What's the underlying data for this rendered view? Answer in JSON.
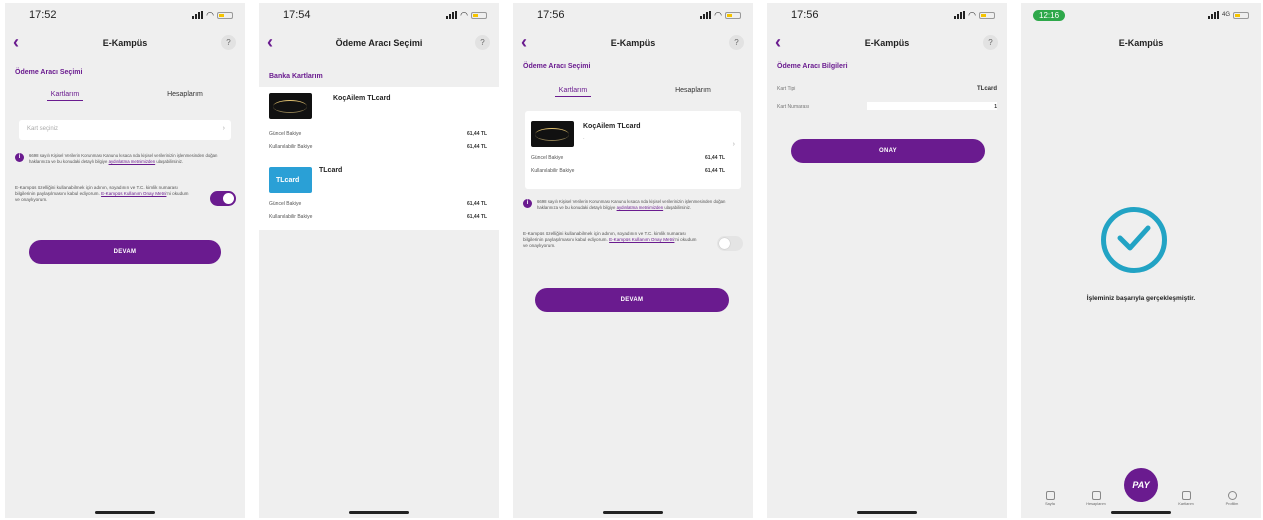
{
  "common": {
    "title_kampus": "E-Kampüs",
    "help": "?",
    "back": "‹",
    "devam": "DEVAM"
  },
  "s1": {
    "time": "17:52",
    "section": "Ödeme Aracı Seçimi",
    "tab_cards": "Kartlarım",
    "tab_accounts": "Hesaplarım",
    "input_placeholder": "Kart seçiniz",
    "info_text": "6698 sayılı Kişisel Verilerin Korunması Kanunu kısaca nda kişisel verilerinizin işlenmesinden doğan haklarınıza ve bu konudaki detaylı bilgiye",
    "info_link": "aydınlatma metnimizden",
    "info_tail": " ulaşabilirsiniz.",
    "consent_text": "E-Kampüs özelliğini kullanabilmek için adının, soyadının ve T.C. kimlik numarası bilgilerinin paylaşılmasını kabul ediyorum.",
    "consent_link": "E-Kampüs Kullanım Onay Metni",
    "consent_tail": "'ni okudum ve onaylıyorum."
  },
  "s2": {
    "time": "17:54",
    "title": "Ödeme Aracı Seçimi",
    "section": "Banka Kartlarım",
    "cards": [
      {
        "name": "KoçAilem TLcard",
        "thumb_label": "",
        "balance_label": "Güncel Bakiye",
        "balance": "61,44 TL",
        "usable_label": "Kullanılabilir Bakiye",
        "usable": "61,44 TL"
      },
      {
        "name": "TLcard",
        "thumb_label": "TLcard",
        "balance_label": "Güncel Bakiye",
        "balance": "61,44 TL",
        "usable_label": "Kullanılabilir Bakiye",
        "usable": "61,44 TL"
      }
    ]
  },
  "s3": {
    "time": "17:56",
    "section": "Ödeme Aracı Seçimi",
    "tab_cards": "Kartlarım",
    "tab_accounts": "Hesaplarım",
    "card": {
      "name": "KoçAilem TLcard",
      "sub": "-",
      "balance_label": "Güncel Bakiye",
      "balance": "61,44 TL",
      "usable_label": "Kullanılabilir Bakiye",
      "usable": "61,44 TL"
    },
    "info_text": "6698 sayılı Kişisel Verilerin Korunması Kanunu kısaca nda kişisel verilerinizin işlenmesinden doğan haklarınıza ve bu konudaki detaylı bilgiye",
    "info_link": "aydınlatma metnimizden",
    "info_tail": " ulaşabilirsiniz.",
    "consent_text": "E-Kampüs özelliğini kullanabilmek için adının, soyadının ve T.C. kimlik numarası bilgilerinin paylaşılmasını kabul ediyorum.",
    "consent_link": "E-Kampüs Kullanım Onay Metni",
    "consent_tail": "'ni okudum ve onaylıyorum."
  },
  "s4": {
    "time": "17:56",
    "section": "Ödeme Aracı Bilgileri",
    "card_type_label": "Kart Tipi",
    "card_type_value": "TLcard",
    "card_no_label": "Kart Numarası",
    "card_no_value": "1",
    "confirm": "ONAY"
  },
  "s5": {
    "time": "12:16",
    "network": "4G",
    "title": "E-Kampüs",
    "success": "İşleminiz başarıyla gerçekleşmiştir.",
    "pay": "PAY",
    "tabs": [
      "Sayfa",
      "Hesaplarım",
      "Kartlarım",
      "Profilim"
    ]
  }
}
